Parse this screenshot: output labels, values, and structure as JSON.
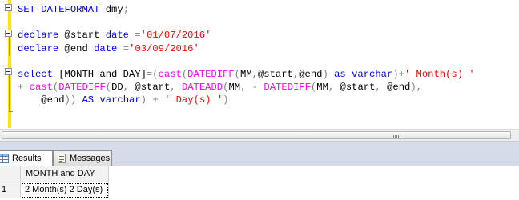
{
  "editor": {
    "lines": [
      [
        {
          "t": "SET",
          "c": "kw"
        },
        {
          "t": " ",
          "c": "txt"
        },
        {
          "t": "DATEFORMAT",
          "c": "kw"
        },
        {
          "t": " dmy",
          "c": "txt"
        },
        {
          "t": ";",
          "c": "op"
        }
      ],
      [],
      [
        {
          "t": "declare",
          "c": "kw"
        },
        {
          "t": " @start ",
          "c": "txt"
        },
        {
          "t": "date",
          "c": "kw"
        },
        {
          "t": " ",
          "c": "txt"
        },
        {
          "t": "=",
          "c": "op"
        },
        {
          "t": "'01/07/2016'",
          "c": "str"
        }
      ],
      [
        {
          "t": "declare",
          "c": "kw"
        },
        {
          "t": " @end ",
          "c": "txt"
        },
        {
          "t": "date",
          "c": "kw"
        },
        {
          "t": " ",
          "c": "txt"
        },
        {
          "t": "=",
          "c": "op"
        },
        {
          "t": "'03/09/2016'",
          "c": "str"
        }
      ],
      [],
      [
        {
          "t": "select",
          "c": "kw"
        },
        {
          "t": " [MONTH and DAY]",
          "c": "txt"
        },
        {
          "t": "=(",
          "c": "op"
        },
        {
          "t": "cast",
          "c": "fn"
        },
        {
          "t": "(",
          "c": "op"
        },
        {
          "t": "DATEDIFF",
          "c": "fn"
        },
        {
          "t": "(",
          "c": "op"
        },
        {
          "t": "MM",
          "c": "txt"
        },
        {
          "t": ",",
          "c": "op"
        },
        {
          "t": "@start",
          "c": "txt"
        },
        {
          "t": ",",
          "c": "op"
        },
        {
          "t": "@end",
          "c": "txt"
        },
        {
          "t": ")",
          "c": "op"
        },
        {
          "t": " ",
          "c": "txt"
        },
        {
          "t": "as",
          "c": "kw"
        },
        {
          "t": " ",
          "c": "txt"
        },
        {
          "t": "varchar",
          "c": "kw"
        },
        {
          "t": ")+",
          "c": "op"
        },
        {
          "t": "' Month(s) '",
          "c": "str"
        }
      ],
      [
        {
          "t": "+",
          "c": "op"
        },
        {
          "t": " ",
          "c": "txt"
        },
        {
          "t": "cast",
          "c": "fn"
        },
        {
          "t": "(",
          "c": "op"
        },
        {
          "t": "DATEDIFF",
          "c": "fn"
        },
        {
          "t": "(",
          "c": "op"
        },
        {
          "t": "DD",
          "c": "txt"
        },
        {
          "t": ",",
          "c": "op"
        },
        {
          "t": " @start",
          "c": "txt"
        },
        {
          "t": ",",
          "c": "op"
        },
        {
          "t": " ",
          "c": "txt"
        },
        {
          "t": "DATEADD",
          "c": "fn"
        },
        {
          "t": "(",
          "c": "op"
        },
        {
          "t": "MM",
          "c": "txt"
        },
        {
          "t": ",",
          "c": "op"
        },
        {
          "t": " ",
          "c": "txt"
        },
        {
          "t": "-",
          "c": "op"
        },
        {
          "t": " ",
          "c": "txt"
        },
        {
          "t": "DATEDIFF",
          "c": "fn"
        },
        {
          "t": "(",
          "c": "op"
        },
        {
          "t": "MM",
          "c": "txt"
        },
        {
          "t": ",",
          "c": "op"
        },
        {
          "t": " @start",
          "c": "txt"
        },
        {
          "t": ",",
          "c": "op"
        },
        {
          "t": " @end",
          "c": "txt"
        },
        {
          "t": "),",
          "c": "op"
        }
      ],
      [
        {
          "t": "    @end",
          "c": "txt"
        },
        {
          "t": "))",
          "c": "op"
        },
        {
          "t": " ",
          "c": "txt"
        },
        {
          "t": "AS",
          "c": "kw"
        },
        {
          "t": " ",
          "c": "txt"
        },
        {
          "t": "varchar",
          "c": "kw"
        },
        {
          "t": ")",
          "c": "op"
        },
        {
          "t": " ",
          "c": "txt"
        },
        {
          "t": "+",
          "c": "op"
        },
        {
          "t": " ",
          "c": "txt"
        },
        {
          "t": "' Day(s) '",
          "c": "str"
        },
        {
          "t": ")",
          "c": "op"
        }
      ]
    ]
  },
  "tabs": {
    "results_label": "Results",
    "messages_label": "Messages"
  },
  "grid": {
    "column_header": "MONTH and DAY",
    "rows": [
      {
        "row_number": "1",
        "value": "2 Month(s) 2 Day(s)"
      }
    ]
  }
}
